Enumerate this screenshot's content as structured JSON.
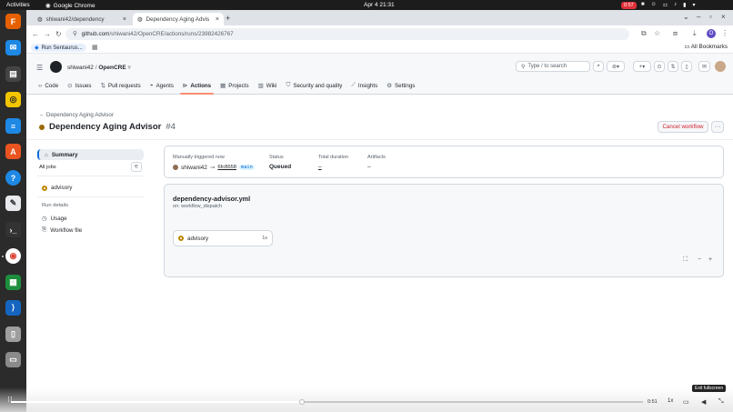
{
  "topbar": {
    "activities": "Activities",
    "app_name": "Google Chrome",
    "clock": "Apr 4  21:31",
    "record_time": "0:57"
  },
  "browser": {
    "tabs": [
      {
        "label": "shiwani42/dependency",
        "active": false
      },
      {
        "label": "Dependency Aging Advis",
        "active": true
      }
    ],
    "url_host": "github.com",
    "url_path": "/shiwani42/OpenCRE/actions/runs/23982426767",
    "profile_initial": "O",
    "bookmark": "Run Sentaurus...",
    "all_bookmarks": "All Bookmarks"
  },
  "github": {
    "owner": "shiwani42",
    "repo": "OpenCRE",
    "search_placeholder": "Type / to search",
    "tabs": [
      {
        "label": "Code",
        "icon": "code-icon"
      },
      {
        "label": "Issues",
        "icon": "issue-icon"
      },
      {
        "label": "Pull requests",
        "icon": "pull-request-icon"
      },
      {
        "label": "Agents",
        "icon": "agent-icon"
      },
      {
        "label": "Actions",
        "icon": "actions-icon"
      },
      {
        "label": "Projects",
        "icon": "projects-icon"
      },
      {
        "label": "Wiki",
        "icon": "wiki-icon"
      },
      {
        "label": "Security and quality",
        "icon": "shield-icon"
      },
      {
        "label": "Insights",
        "icon": "graph-icon"
      },
      {
        "label": "Settings",
        "icon": "gear-icon"
      }
    ],
    "active_tab": "Actions",
    "back_link": "Dependency Aging Advisor",
    "run_title": "Dependency Aging Advisor",
    "run_number": "#4",
    "cancel_label": "Cancel workflow",
    "sidebar": {
      "summary": "Summary",
      "all_jobs": "All jobs",
      "job": "advisory",
      "run_details": "Run details",
      "usage": "Usage",
      "workflow_file": "Workflow file"
    },
    "summary_card": {
      "trigger_label": "Manually triggered now",
      "user": "shiwani42",
      "commit": "6fc8658",
      "branch": "main",
      "status_label": "Status",
      "status": "Queued",
      "duration_label": "Total duration",
      "duration": "–",
      "artifacts_label": "Artifacts",
      "artifacts": "–"
    },
    "workflow": {
      "file": "dependency-advisor.yml",
      "trigger": "on: workflow_dispatch",
      "job": "advisory",
      "job_duration": "1s"
    }
  },
  "video": {
    "time": "0:51",
    "speed": "1x",
    "progress": 0.46,
    "exit_fullscreen": "Exit fullscreen"
  }
}
